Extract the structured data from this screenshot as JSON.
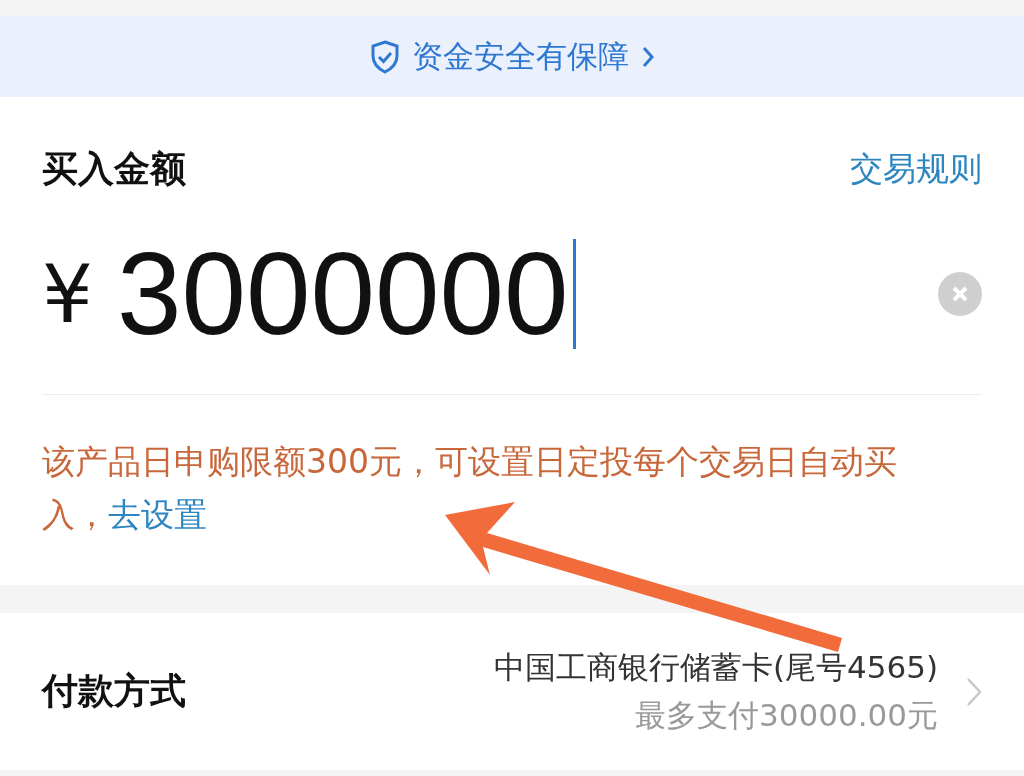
{
  "banner": {
    "text": "资金安全有保障"
  },
  "amount": {
    "title": "买入金额",
    "rules_link": "交易规则",
    "currency": "¥",
    "value": "3000000"
  },
  "notice": {
    "text": "该产品日申购限额300元，可设置日定投每个交易日自动买入，",
    "link": "去设置"
  },
  "payment": {
    "label": "付款方式",
    "card": "中国工商银行储蓄卡(尾号4565)",
    "limit": "最多支付30000.00元"
  }
}
